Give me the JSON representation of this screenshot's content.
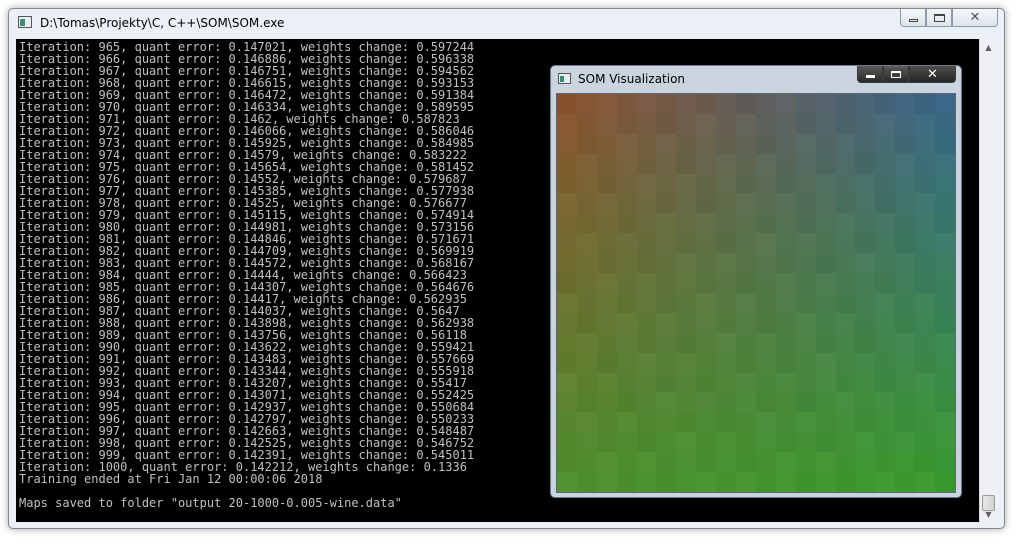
{
  "console": {
    "title": "D:\\Tomas\\Projekty\\C, C++\\SOM\\SOM.exe",
    "lines": [
      "Iteration: 965, quant error: 0.147021, weights change: 0.597244",
      "Iteration: 966, quant error: 0.146886, weights change: 0.596338",
      "Iteration: 967, quant error: 0.146751, weights change: 0.594562",
      "Iteration: 968, quant error: 0.146615, weights change: 0.593153",
      "Iteration: 969, quant error: 0.146472, weights change: 0.591384",
      "Iteration: 970, quant error: 0.146334, weights change: 0.589595",
      "Iteration: 971, quant error: 0.1462, weights change: 0.587823",
      "Iteration: 972, quant error: 0.146066, weights change: 0.586046",
      "Iteration: 973, quant error: 0.145925, weights change: 0.584985",
      "Iteration: 974, quant error: 0.14579, weights change: 0.583222",
      "Iteration: 975, quant error: 0.145654, weights change: 0.581452",
      "Iteration: 976, quant error: 0.14552, weights change: 0.579687",
      "Iteration: 977, quant error: 0.145385, weights change: 0.577938",
      "Iteration: 978, quant error: 0.14525, weights change: 0.576677",
      "Iteration: 979, quant error: 0.145115, weights change: 0.574914",
      "Iteration: 980, quant error: 0.144981, weights change: 0.573156",
      "Iteration: 981, quant error: 0.144846, weights change: 0.571671",
      "Iteration: 982, quant error: 0.144709, weights change: 0.569919",
      "Iteration: 983, quant error: 0.144572, weights change: 0.568167",
      "Iteration: 984, quant error: 0.14444, weights change: 0.566423",
      "Iteration: 985, quant error: 0.144307, weights change: 0.564676",
      "Iteration: 986, quant error: 0.14417, weights change: 0.562935",
      "Iteration: 987, quant error: 0.144037, weights change: 0.5647",
      "Iteration: 988, quant error: 0.143898, weights change: 0.562938",
      "Iteration: 989, quant error: 0.143756, weights change: 0.56118",
      "Iteration: 990, quant error: 0.143622, weights change: 0.559421",
      "Iteration: 991, quant error: 0.143483, weights change: 0.557669",
      "Iteration: 992, quant error: 0.143344, weights change: 0.555918",
      "Iteration: 993, quant error: 0.143207, weights change: 0.55417",
      "Iteration: 994, quant error: 0.143071, weights change: 0.552425",
      "Iteration: 995, quant error: 0.142937, weights change: 0.550684",
      "Iteration: 996, quant error: 0.142797, weights change: 0.550233",
      "Iteration: 997, quant error: 0.142663, weights change: 0.548487",
      "Iteration: 998, quant error: 0.142525, weights change: 0.546752",
      "Iteration: 999, quant error: 0.142391, weights change: 0.545011",
      "Iteration: 1000, quant error: 0.142212, weights change: 0.1336",
      "Training ended at Fri Jan 12 00:00:06 2018",
      "",
      "Maps saved to folder \"output 20-1000-0.005-wine.data\""
    ]
  },
  "som_window": {
    "title": "SOM Visualization",
    "grid_size": 20,
    "corner_colors": {
      "top_left": "#8a5530",
      "top_right": "#3a6888",
      "bottom_left": "#4f8f2e",
      "bottom_right": "#3a9a30"
    }
  },
  "icons": {
    "minimize": "minimize-icon",
    "maximize": "maximize-icon",
    "close": "close-icon",
    "scroll_up": "scroll-up-arrow-icon",
    "scroll_down": "scroll-down-arrow-icon"
  }
}
